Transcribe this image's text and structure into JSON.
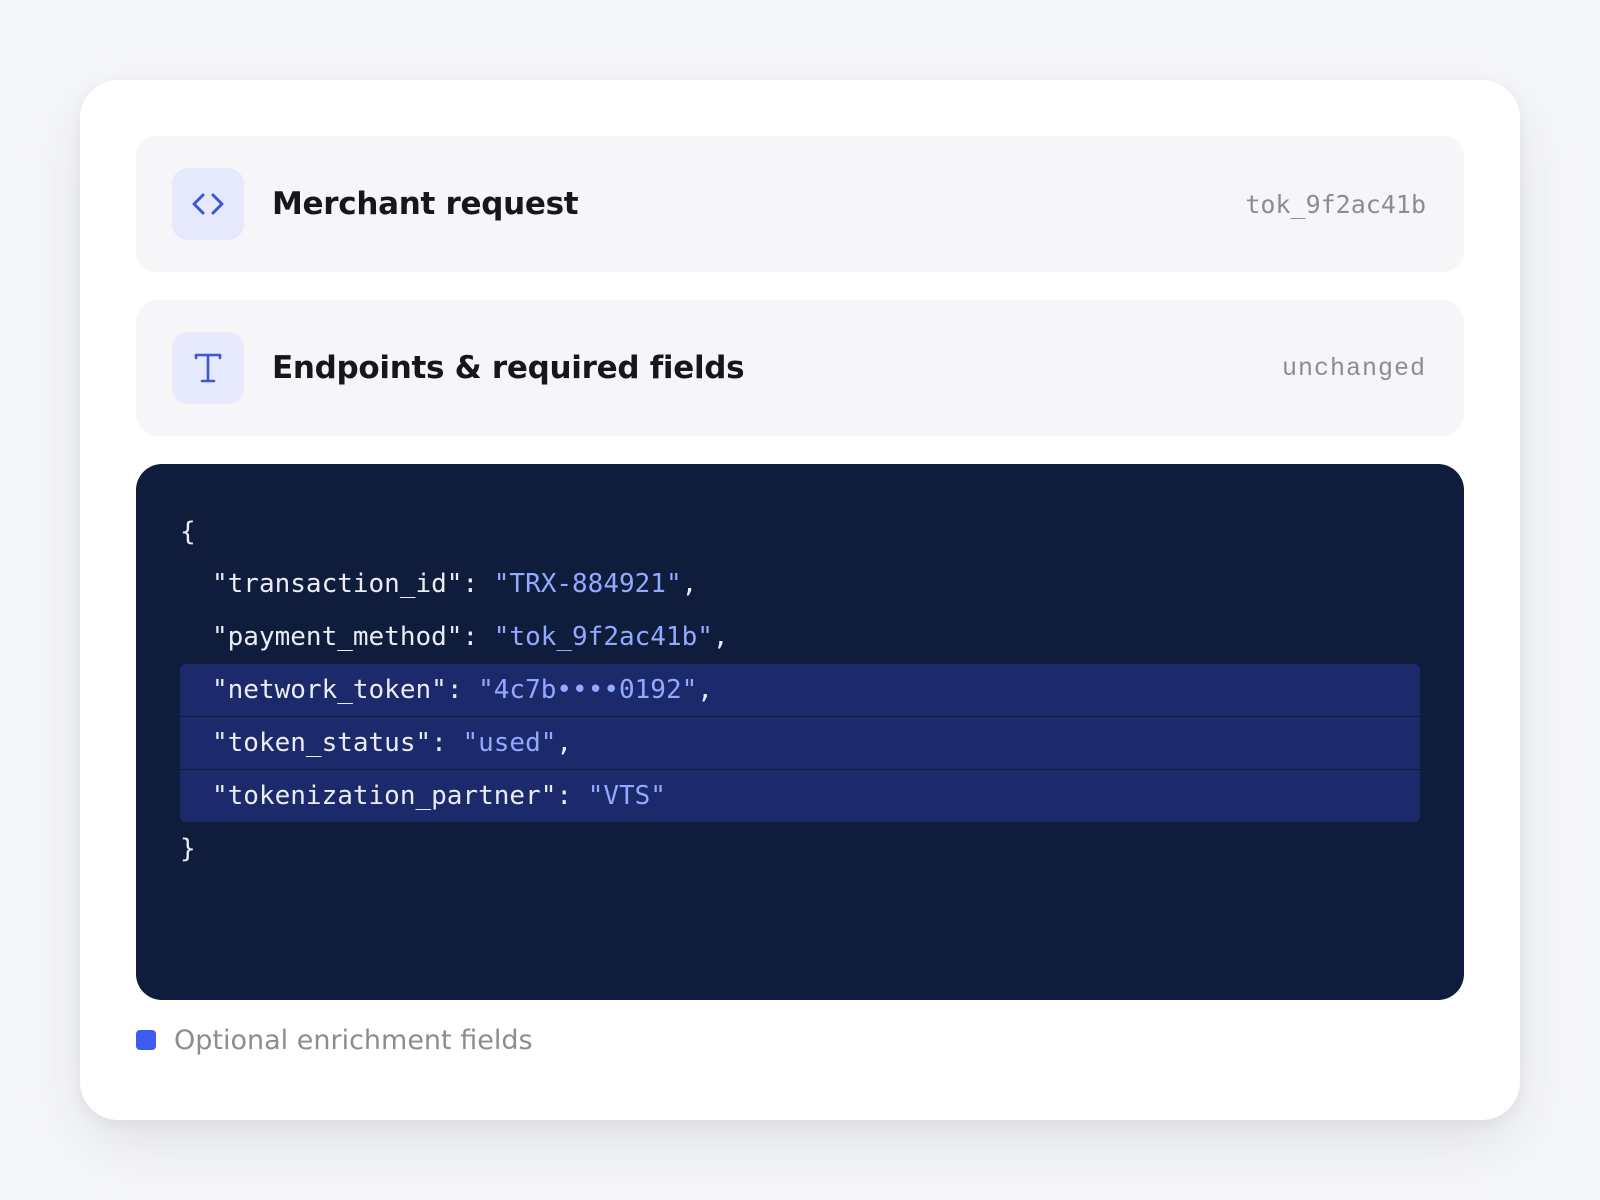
{
  "panels": [
    {
      "title": "Merchant request",
      "meta": "tok_9f2ac41b",
      "icon": "code-brackets-icon"
    },
    {
      "title": "Endpoints & required fields",
      "meta": "unchanged",
      "icon": "text-type-icon"
    }
  ],
  "code": {
    "open_brace": "{",
    "close_brace": "}",
    "lines": [
      {
        "key": "\"transaction_id\"",
        "value": "\"TRX-884921\"",
        "suffix": ",",
        "highlighted": false
      },
      {
        "key": "\"payment_method\"",
        "value": "\"tok_9f2ac41b\"",
        "suffix": ",",
        "highlighted": false
      },
      {
        "key": "\"network_token\"",
        "value": "\"4c7b••••0192\"",
        "suffix": ",",
        "highlighted": true
      },
      {
        "key": "\"token_status\"",
        "value": "\"used\"",
        "suffix": ",",
        "highlighted": true
      },
      {
        "key": "\"tokenization_partner\"",
        "value": "\"VTS\"",
        "suffix": "",
        "highlighted": true
      }
    ]
  },
  "legend": {
    "label": "Optional enrichment fields",
    "color": "#3d5bf0"
  },
  "colors": {
    "accent": "#3d5bf0",
    "code_bg": "#0f1c3b",
    "highlight_bg": "#1c2a6b",
    "string": "#93a8ff"
  }
}
